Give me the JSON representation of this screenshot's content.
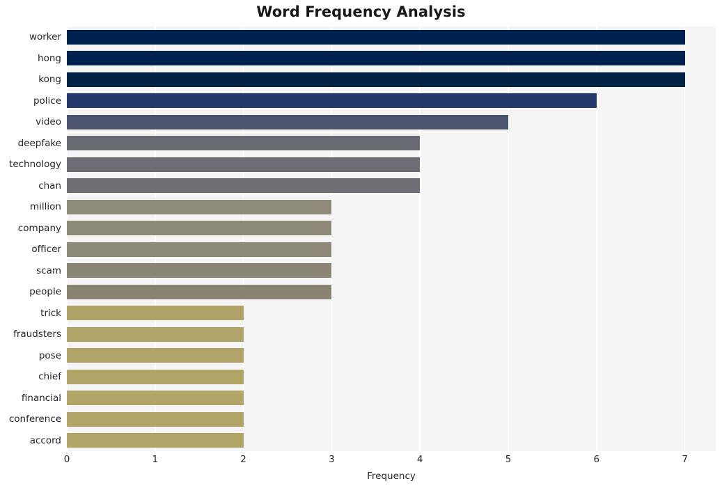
{
  "chart_data": {
    "type": "bar",
    "orientation": "horizontal",
    "title": "Word Frequency Analysis",
    "xlabel": "Frequency",
    "ylabel": "",
    "xlim": [
      0,
      7.35
    ],
    "ylim": [
      0,
      20
    ],
    "grid": true,
    "grid_axis": "both",
    "legend": false,
    "xticks": [
      "0",
      "1",
      "2",
      "3",
      "4",
      "5",
      "6",
      "7"
    ],
    "xtick_values": [
      0,
      1,
      2,
      3,
      4,
      5,
      6,
      7
    ],
    "categories": [
      "worker",
      "hong",
      "kong",
      "police",
      "video",
      "deepfake",
      "technology",
      "chan",
      "million",
      "company",
      "officer",
      "scam",
      "people",
      "trick",
      "fraudsters",
      "pose",
      "chief",
      "financial",
      "conference",
      "accord"
    ],
    "values": [
      7,
      7,
      7,
      6,
      5,
      4,
      4,
      4,
      3,
      3,
      3,
      3,
      3,
      2,
      2,
      2,
      2,
      2,
      2,
      2
    ],
    "bar_colors": [
      "#00224e",
      "#00224e",
      "#012344",
      "#25386b",
      "#4c556f",
      "#6a6a72",
      "#6d6d73",
      "#6e6e74",
      "#8f8b78",
      "#8d8976",
      "#8c8776",
      "#8a8575",
      "#898472",
      "#b0a367",
      "#b1a468",
      "#b2a468",
      "#b2a568",
      "#b3a568",
      "#b3a568",
      "#b3a568"
    ],
    "colormap": "cividis",
    "plot_background": "#f5f5f6",
    "grid_color": "#ffffff",
    "title_color": "#181818",
    "tick_color": "#262626"
  }
}
